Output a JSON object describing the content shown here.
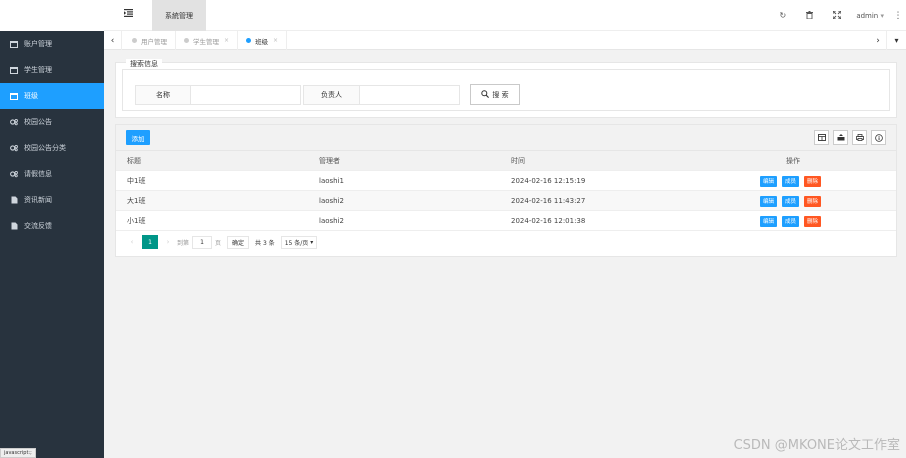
{
  "header": {
    "top_tab": "系統管理",
    "user": "admin"
  },
  "sidebar": {
    "items": [
      {
        "label": "账户管理",
        "icon": "window-icon"
      },
      {
        "label": "学生管理",
        "icon": "window-icon"
      },
      {
        "label": "班级",
        "icon": "window-icon",
        "active": true
      },
      {
        "label": "校园公告",
        "icon": "gears-icon"
      },
      {
        "label": "校园公告分类",
        "icon": "gears-icon"
      },
      {
        "label": "请假信息",
        "icon": "gears-icon"
      },
      {
        "label": "资讯新闻",
        "icon": "file-icon"
      },
      {
        "label": "交流反馈",
        "icon": "file-icon"
      }
    ],
    "status_tip": "javascript:;"
  },
  "tabs": [
    {
      "label": "用户管理"
    },
    {
      "label": "学生管理"
    },
    {
      "label": "班级",
      "active": true
    }
  ],
  "search": {
    "legend": "搜索信息",
    "name_label": "名称",
    "owner_label": "负责人",
    "button": "搜 索"
  },
  "table": {
    "add_label": "添加",
    "headers": [
      "标题",
      "管理者",
      "时间",
      "操作"
    ],
    "rows": [
      {
        "title": "中1班",
        "manager": "laoshi1",
        "time": "2024-02-16 12:15:19"
      },
      {
        "title": "大1班",
        "manager": "laoshi2",
        "time": "2024-02-16 11:43:27"
      },
      {
        "title": "小1班",
        "manager": "laoshi2",
        "time": "2024-02-16 12:01:38"
      }
    ],
    "ops": {
      "edit": "编辑",
      "member": "成员",
      "delete": "删除"
    }
  },
  "pager": {
    "current": "1",
    "goto_label": "到第",
    "goto_value": "1",
    "page_unit": "页",
    "confirm": "确定",
    "total": "共 3 条",
    "size": "15 条/页"
  },
  "watermark": "CSDN @MKONE论文工作室"
}
